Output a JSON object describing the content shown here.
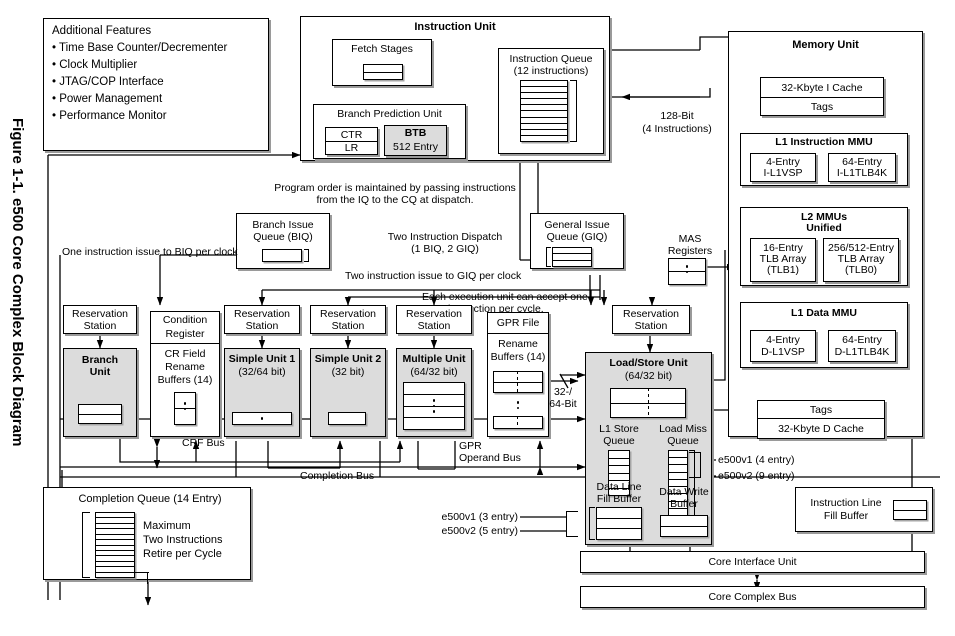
{
  "figure": {
    "caption": "Figure 1-1. e500 Core Complex Block Diagram"
  },
  "additional_features": {
    "title": "Additional Features",
    "items": [
      "• Time Base Counter/Decrementer",
      "• Clock Multiplier",
      "• JTAG/COP Interface",
      "• Power Management",
      "• Performance Monitor"
    ]
  },
  "instruction_unit": {
    "title": "Instruction Unit",
    "fetch_stages": "Fetch Stages",
    "branch_prediction_unit": "Branch Prediction Unit",
    "ctr": "CTR",
    "lr": "LR",
    "btb_line1": "BTB",
    "btb_line2": "512 Entry",
    "instruction_queue_line1": "Instruction Queue",
    "instruction_queue_line2": "(12 instructions)"
  },
  "bus_labels": {
    "bit128_line1": "128-Bit",
    "bit128_line2": "(4 Instructions)",
    "program_order_line1": "Program order is maintained by passing instructions",
    "program_order_line2": "from the IQ to the CQ at dispatch.",
    "two_dispatch_line1": "Two Instruction Dispatch",
    "two_dispatch_line2": "(1 BIQ, 2 GIQ)",
    "one_issue_biq": "One instruction issue to BIQ per clock",
    "two_issue_giq": "Two instruction issue to GIQ per clock",
    "each_exec_line1": "Each execution unit can accept one",
    "each_exec_line2": "instruction per cycle.",
    "crf_bus": "CRF Bus",
    "completion_bus": "Completion Bus",
    "gpr_operand_bus_line1": "GPR",
    "gpr_operand_bus_line2": "Operand Bus",
    "width_line1": "32-/",
    "width_line2": "64-Bit"
  },
  "queues": {
    "biq_line1": "Branch Issue",
    "biq_line2": "Queue (BIQ)",
    "giq_line1": "General Issue",
    "giq_line2": "Queue (GIQ)",
    "mas_line1": "MAS",
    "mas_line2": "Registers"
  },
  "execution": {
    "reservation_station": "Reservation\nStation",
    "branch_unit": "Branch\nUnit",
    "condition_register_line1": "Condition",
    "condition_register_line2": "Register",
    "cr_field_rename_line1": "CR Field",
    "cr_field_rename_line2": "Rename",
    "cr_field_rename_line3": "Buffers (14)",
    "simple_unit_1_name": "Simple Unit 1",
    "simple_unit_1_width": "(32/64 bit)",
    "simple_unit_2_name": "Simple Unit 2",
    "simple_unit_2_width": "(32 bit)",
    "multiple_unit_name": "Multiple Unit",
    "multiple_unit_width": "(64/32 bit)",
    "gpr_file": "GPR File",
    "rename_buffers_line1": "Rename",
    "rename_buffers_line2": "Buffers (14)"
  },
  "load_store": {
    "title": "Load/Store Unit",
    "width": "(64/32 bit)",
    "l1_store_queue_line1": "L1 Store",
    "l1_store_queue_line2": "Queue",
    "load_miss_queue_line1": "Load Miss",
    "load_miss_queue_line2": "Queue",
    "data_line_fill_line1": "Data Line",
    "data_line_fill_line2": "Fill Buffer",
    "data_write_buffer_line1": "Data Write",
    "data_write_buffer_line2": "Buffer",
    "lmq_e500v1": "e500v1 (4 entry)",
    "lmq_e500v2": "e500v2 (9 entry)",
    "dlfb_e500v1": "e500v1 (3 entry)",
    "dlfb_e500v2": "e500v2 (5 entry)"
  },
  "completion_queue": {
    "title": "Completion Queue (14 Entry)",
    "note_line1": "Maximum",
    "note_line2": "Two Instructions",
    "note_line3": "Retire per Cycle"
  },
  "memory_unit": {
    "title": "Memory Unit",
    "i_cache": "32-Kbyte I Cache",
    "i_cache_tags": "Tags",
    "l1_instruction_mmu": "L1 Instruction MMU",
    "i_l1vsp_line1": "4-Entry",
    "i_l1vsp_line2": "I-L1VSP",
    "i_l1tlb4k_line1": "64-Entry",
    "i_l1tlb4k_line2": "I-L1TLB4K",
    "l2_mmus_line1": "L2 MMUs",
    "l2_mmus_line2": "Unified",
    "tlb1_line1": "16-Entry",
    "tlb1_line2": "TLB Array",
    "tlb1_line3": "(TLB1)",
    "tlb0_line1": "256/512-Entry",
    "tlb0_line2": "TLB Array",
    "tlb0_line3": "(TLB0)",
    "l1_data_mmu": "L1 Data MMU",
    "d_l1vsp_line1": "4-Entry",
    "d_l1vsp_line2": "D-L1VSP",
    "d_l1tlb4k_line1": "64-Entry",
    "d_l1tlb4k_line2": "D-L1TLB4K",
    "d_cache_tags": "Tags",
    "d_cache": "32-Kbyte D Cache"
  },
  "instruction_line_fill_buffer": {
    "line1": "Instruction Line",
    "line2": "Fill Buffer"
  },
  "bottom": {
    "core_interface_unit": "Core Interface Unit",
    "core_complex_bus": "Core Complex Bus"
  },
  "colors": {
    "ink": "#000000",
    "fill_grey": "#dcdcdc",
    "shadow": "#9a9a9a"
  }
}
